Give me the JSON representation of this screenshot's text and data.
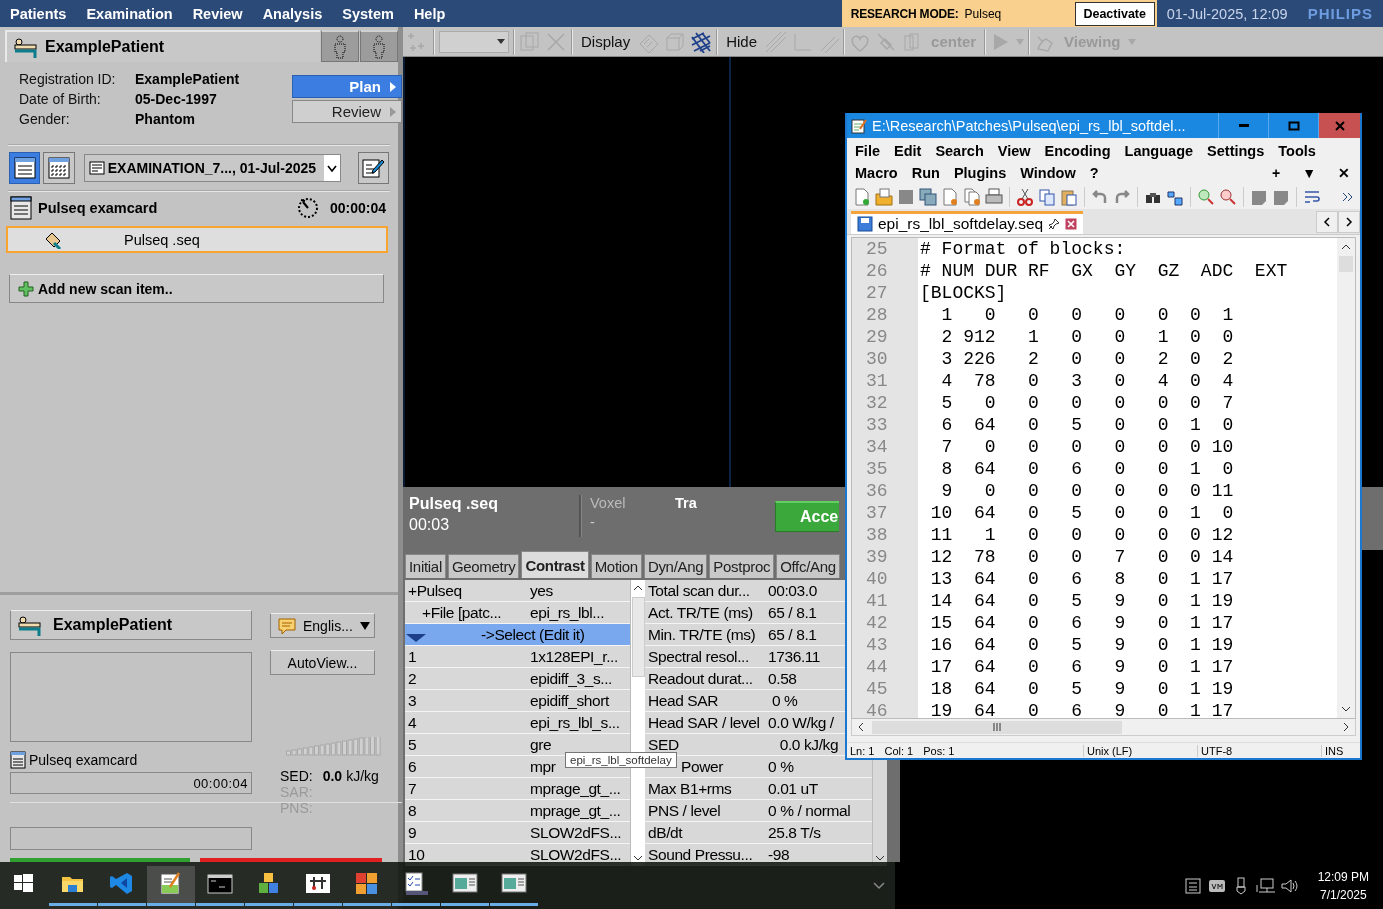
{
  "menubar": {
    "items": [
      "Patients",
      "Examination",
      "Review",
      "Analysis",
      "System",
      "Help"
    ],
    "research_mode": {
      "label": "RESEARCH MODE:",
      "value": "Pulseq",
      "button": "Deactivate"
    },
    "datetime": "01-Jul-2025, 12:09",
    "logo": "PHILIPS"
  },
  "patient_panel": {
    "name": "ExamplePatient",
    "fields": [
      {
        "label": "Registration ID:",
        "value": "ExamplePatient"
      },
      {
        "label": "Date of Birth:",
        "value": "05-Dec-1997"
      },
      {
        "label": "Gender:",
        "value": "Phantom"
      }
    ],
    "modes": [
      {
        "label": "Plan",
        "selected": true
      },
      {
        "label": "Review",
        "selected": false
      }
    ],
    "view_buttons": [
      {
        "kind": "list",
        "selected": true
      },
      {
        "kind": "grid",
        "selected": false
      }
    ],
    "examination": "EXAMINATION_7..., 01-Jul-2025",
    "examcard": {
      "title": "Pulseq examcard",
      "duration": "00:00:04"
    },
    "scan_items": [
      {
        "label": "Pulseq .seq",
        "selected": true
      }
    ],
    "add_button": "Add new scan item.."
  },
  "status_panel": {
    "patient": "ExamplePatient",
    "language": "Englis...",
    "autoview": "AutoView...",
    "examcard": "Pulseq examcard",
    "elapsed": "00:00:04",
    "sed": {
      "label": "SED:",
      "value": "0.0",
      "unit": "kJ/kg"
    },
    "sar_label": "SAR:",
    "pns_label": "PNS:"
  },
  "viewer_toolbar": {
    "labels": [
      {
        "text": "Display",
        "disabled": false
      },
      {
        "text": "Hide",
        "disabled": false
      },
      {
        "text": "center",
        "disabled": true
      },
      {
        "text": "Viewing",
        "disabled": true
      }
    ]
  },
  "scan_info": {
    "name": "Pulseq .seq",
    "time": "00:03",
    "voxel_label": "Voxel",
    "voxel_value": "-",
    "orientation": "Tra",
    "accept_button": "Acce"
  },
  "param_tabs": [
    {
      "label": "Initial",
      "selected": false
    },
    {
      "label": "Geometry",
      "selected": false
    },
    {
      "label": "Contrast",
      "selected": true
    },
    {
      "label": "Motion",
      "selected": false
    },
    {
      "label": "Dyn/Ang",
      "selected": false
    },
    {
      "label": "Postproc",
      "selected": false
    },
    {
      "label": "Offc/Ang",
      "selected": false
    }
  ],
  "parameters": [
    {
      "kind": "group",
      "name": "+Pulseq",
      "value": "yes",
      "selected": false
    },
    {
      "kind": "subgroup",
      "name": "+File [patc...",
      "value": "epi_rs_lbl...",
      "selected": false
    },
    {
      "kind": "selector",
      "value": "->Select (Edit it)",
      "selected": true
    },
    {
      "kind": "item",
      "name": "1",
      "value": "1x128EPI_r...",
      "selected": false
    },
    {
      "kind": "item",
      "name": "2",
      "value": "epidiff_3_s...",
      "selected": false
    },
    {
      "kind": "item",
      "name": "3",
      "value": "epidiff_short",
      "selected": false
    },
    {
      "kind": "item",
      "name": "4",
      "value": "epi_rs_lbl_s...",
      "selected": false
    },
    {
      "kind": "item",
      "name": "5",
      "value": "gre",
      "selected": false
    },
    {
      "kind": "item",
      "name": "6",
      "value": "mpr",
      "selected": false
    },
    {
      "kind": "item",
      "name": "7",
      "value": "mprage_gt_...",
      "selected": false
    },
    {
      "kind": "item",
      "name": "8",
      "value": "mprage_gt_...",
      "selected": false
    },
    {
      "kind": "item",
      "name": "9",
      "value": "SLOW2dFS...",
      "selected": false
    },
    {
      "kind": "item",
      "name": "10",
      "value": "SLOW2dFS...",
      "selected": false
    }
  ],
  "scan_values": [
    {
      "label": "Total scan dur...",
      "value": "00:03.0"
    },
    {
      "label": "Act. TR/TE (ms)",
      "value": "65 / 8.1"
    },
    {
      "label": "Min. TR/TE (ms)",
      "value": "65 / 8.1"
    },
    {
      "label": "Spectral resol...",
      "value": "1736.11"
    },
    {
      "label": "Readout durat...",
      "value": "0.58"
    },
    {
      "label": "Head SAR",
      "value": " 0 %"
    },
    {
      "label": "Head SAR / level",
      "value": "0.0 W/kg /"
    },
    {
      "label": "SED",
      "value": "   0.0 kJ/kg"
    },
    {
      "label": "Power",
      "value": "0 %"
    },
    {
      "label": "Max B1+rms",
      "value": "0.01 uT"
    },
    {
      "label": "PNS / level",
      "value": "0 % / normal"
    },
    {
      "label": "dB/dt",
      "value": "25.8 T/s"
    },
    {
      "label": "Sound Pressu...",
      "value": "-98"
    }
  ],
  "tooltip": "epi_rs_lbl_softdelay",
  "editor_window": {
    "title": "E:\\Research\\Patches\\Pulseq\\epi_rs_lbl_softdel...",
    "menu": [
      [
        "File",
        "Edit",
        "Search",
        "View",
        "Encoding",
        "Language",
        "Settings",
        "Tools"
      ],
      [
        "Macro",
        "Run",
        "Plugins",
        "Window",
        "?"
      ]
    ],
    "menu_controls": [
      "+",
      "▼",
      "✕"
    ],
    "tab": {
      "label": "epi_rs_lbl_softdelay.seq",
      "selected": true
    },
    "lines": [
      {
        "number": "25",
        "text": "# Format of blocks:"
      },
      {
        "number": "26",
        "text": "# NUM DUR RF  GX  GY  GZ  ADC  EXT"
      },
      {
        "number": "27",
        "text": "[BLOCKS]"
      },
      {
        "number": "28",
        "text": "  1   0   0   0   0   0  0  1"
      },
      {
        "number": "29",
        "text": "  2 912   1   0   0   1  0  0"
      },
      {
        "number": "30",
        "text": "  3 226   2   0   0   2  0  2"
      },
      {
        "number": "31",
        "text": "  4  78   0   3   0   4  0  4"
      },
      {
        "number": "32",
        "text": "  5   0   0   0   0   0  0  7"
      },
      {
        "number": "33",
        "text": "  6  64   0   5   0   0  1  0"
      },
      {
        "number": "34",
        "text": "  7   0   0   0   0   0  0 10"
      },
      {
        "number": "35",
        "text": "  8  64   0   6   0   0  1  0"
      },
      {
        "number": "36",
        "text": "  9   0   0   0   0   0  0 11"
      },
      {
        "number": "37",
        "text": " 10  64   0   5   0   0  1  0"
      },
      {
        "number": "38",
        "text": " 11   1   0   0   0   0  0 12"
      },
      {
        "number": "39",
        "text": " 12  78   0   0   7   0  0 14"
      },
      {
        "number": "40",
        "text": " 13  64   0   6   8   0  1 17"
      },
      {
        "number": "41",
        "text": " 14  64   0   5   9   0  1 19"
      },
      {
        "number": "42",
        "text": " 15  64   0   6   9   0  1 17"
      },
      {
        "number": "43",
        "text": " 16  64   0   5   9   0  1 19"
      },
      {
        "number": "44",
        "text": " 17  64   0   6   9   0  1 17"
      },
      {
        "number": "45",
        "text": " 18  64   0   5   9   0  1 19"
      },
      {
        "number": "46",
        "text": " 19  64   0   6   9   0  1 17"
      }
    ],
    "status": {
      "position": [
        "Ln: 1",
        "Col: 1",
        "Pos: 1"
      ],
      "eol": "Unix (LF)",
      "encoding": "UTF-8",
      "mode": "INS"
    }
  },
  "taskbar": {
    "apps": [
      {
        "kind": "start",
        "active": false
      },
      {
        "kind": "folder",
        "active": false
      },
      {
        "kind": "code",
        "active": false
      },
      {
        "kind": "notepad",
        "active": true
      },
      {
        "kind": "terminal",
        "active": false
      },
      {
        "kind": "blocks",
        "active": false
      },
      {
        "kind": "tool",
        "active": false
      },
      {
        "kind": "tiles",
        "active": false
      },
      {
        "kind": "checklist",
        "active": false
      },
      {
        "kind": "window",
        "active": false
      },
      {
        "kind": "window",
        "active": false
      }
    ],
    "time": "12:09 PM",
    "date": "7/1/2025"
  }
}
